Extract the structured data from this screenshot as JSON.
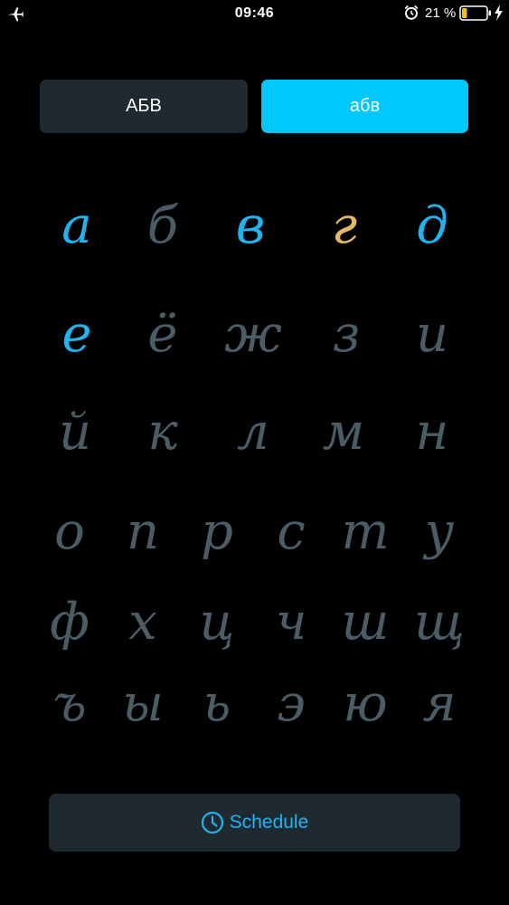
{
  "status_bar": {
    "time": "09:46",
    "battery_text": "21 %",
    "battery_level": 0.21,
    "icons": [
      "airplane-icon",
      "alarm-icon",
      "battery-icon",
      "charging-bolt-icon"
    ]
  },
  "case_toggle": {
    "upper_label": "АБВ",
    "lower_label": "абв",
    "selected": "lower"
  },
  "letters": [
    {
      "char": "а",
      "state": "active"
    },
    {
      "char": "б",
      "state": "inactive"
    },
    {
      "char": "в",
      "state": "active"
    },
    {
      "char": "г",
      "state": "current"
    },
    {
      "char": "д",
      "state": "active"
    },
    {
      "char": "е",
      "state": "active"
    },
    {
      "char": "ё",
      "state": "inactive"
    },
    {
      "char": "ж",
      "state": "inactive"
    },
    {
      "char": "з",
      "state": "inactive"
    },
    {
      "char": "и",
      "state": "inactive"
    },
    {
      "char": "й",
      "state": "inactive"
    },
    {
      "char": "к",
      "state": "inactive"
    },
    {
      "char": "л",
      "state": "inactive"
    },
    {
      "char": "м",
      "state": "inactive"
    },
    {
      "char": "н",
      "state": "inactive"
    },
    {
      "char": "о",
      "state": "inactive"
    },
    {
      "char": "п",
      "state": "inactive"
    },
    {
      "char": "р",
      "state": "inactive"
    },
    {
      "char": "с",
      "state": "inactive"
    },
    {
      "char": "т",
      "state": "inactive"
    },
    {
      "char": "у",
      "state": "inactive"
    },
    {
      "char": "ф",
      "state": "inactive"
    },
    {
      "char": "х",
      "state": "inactive"
    },
    {
      "char": "ц",
      "state": "inactive"
    },
    {
      "char": "ч",
      "state": "inactive"
    },
    {
      "char": "ш",
      "state": "inactive"
    },
    {
      "char": "щ",
      "state": "inactive"
    },
    {
      "char": "ъ",
      "state": "inactive"
    },
    {
      "char": "ы",
      "state": "inactive"
    },
    {
      "char": "ь",
      "state": "inactive"
    },
    {
      "char": "э",
      "state": "inactive"
    },
    {
      "char": "ю",
      "state": "inactive"
    },
    {
      "char": "я",
      "state": "inactive"
    }
  ],
  "schedule_button": {
    "label": "Schedule",
    "icon": "clock-icon"
  },
  "colors": {
    "background": "#000000",
    "accent": "#00c8ff",
    "active_letter": "#1fb4f0",
    "current_letter": "#e3b865",
    "inactive_letter": "#4a5d66",
    "button_bg": "#1e2a30",
    "battery_fill": "#f4c20d"
  }
}
